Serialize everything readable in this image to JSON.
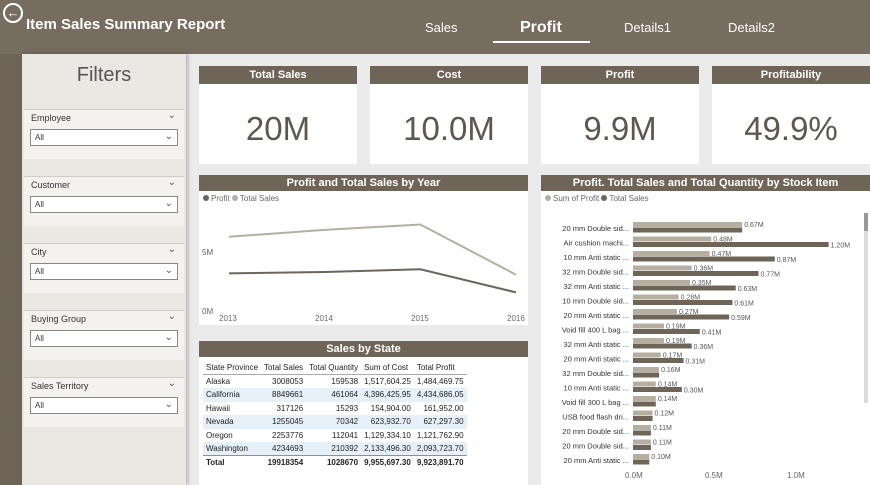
{
  "header": {
    "title": "Item Sales Summary Report",
    "tabs": [
      {
        "label": "Sales",
        "active": false
      },
      {
        "label": "Profit",
        "active": true
      },
      {
        "label": "Details1",
        "active": false
      },
      {
        "label": "Details2",
        "active": false
      }
    ]
  },
  "filters": {
    "title": "Filters",
    "slicers": [
      {
        "label": "Employee",
        "value": "All"
      },
      {
        "label": "Customer",
        "value": "All"
      },
      {
        "label": "City",
        "value": "All"
      },
      {
        "label": "Buying Group",
        "value": "All"
      },
      {
        "label": "Sales Territory",
        "value": "All"
      }
    ]
  },
  "cards": [
    {
      "title": "Total Sales",
      "value": "20M"
    },
    {
      "title": "Cost",
      "value": "10.0M"
    },
    {
      "title": "Profit",
      "value": "9.9M"
    },
    {
      "title": "Profitability",
      "value": "49.9%"
    }
  ],
  "colors": {
    "profit": "#6e6558",
    "sales": "#b7aea2",
    "header": "#766c5f"
  },
  "year_chart": {
    "title": "Profit and Total Sales by Year",
    "legend": [
      "Profit",
      "Total Sales"
    ],
    "y_ticks": [
      "5M",
      "0M"
    ],
    "x_ticks": [
      "2013",
      "2014",
      "2015",
      "2016"
    ]
  },
  "state_table": {
    "title": "Sales by State",
    "columns": [
      "State Province",
      "Total Sales",
      "Total Quantity",
      "Sum of Cost",
      "Total Profit"
    ],
    "rows": [
      [
        "Alaska",
        "3008053",
        "159538",
        "1,517,604.25",
        "1,484,469.75"
      ],
      [
        "California",
        "8849661",
        "461064",
        "4,396,425.95",
        "4,434,686.05"
      ],
      [
        "Hawaii",
        "317126",
        "15293",
        "154,904.00",
        "161,952.00"
      ],
      [
        "Nevada",
        "1255045",
        "70342",
        "623,932.70",
        "627,297.30"
      ],
      [
        "Oregon",
        "2253776",
        "112041",
        "1,129,334.10",
        "1,121,762.90"
      ],
      [
        "Washington",
        "4234693",
        "210392",
        "2,133,496.30",
        "2,093,723.70"
      ]
    ],
    "total": [
      "Total",
      "19918354",
      "1028670",
      "9,955,697.30",
      "9,923,891.70"
    ]
  },
  "item_chart": {
    "title": "Profit. Total Sales and Total Quantity by Stock Item",
    "legend": [
      "Sum of Profit",
      "Total Sales"
    ],
    "x_ticks": [
      "0.0M",
      "0.5M",
      "1.0M"
    ]
  },
  "chart_data": [
    {
      "type": "line",
      "title": "Profit and Total Sales by Year",
      "x": [
        2013,
        2014,
        2015,
        2016
      ],
      "series": [
        {
          "name": "Profit",
          "values": [
            2.7,
            2.8,
            3.0,
            1.3
          ]
        },
        {
          "name": "Total Sales",
          "values": [
            5.4,
            5.9,
            6.3,
            2.6
          ]
        }
      ],
      "y_unit": "M",
      "ylim": [
        0,
        7
      ],
      "legend_position": "top-left"
    },
    {
      "type": "bar",
      "orientation": "horizontal",
      "title": "Profit. Total Sales and Total Quantity by Stock Item",
      "categories": [
        "20 mm Double sid...",
        "Air cushion machi...",
        "10 mm Anti static ...",
        "32 mm Double sid...",
        "32 mm Anti static ...",
        "10 mm Double sid...",
        "20 mm Anti static ...",
        "Void fill 400 L bag ...",
        "32 mm Anti static ...",
        "20 mm Anti static ...",
        "32 mm Double sid...",
        "10 mm Anti static ...",
        "Void fill 300 L bag ...",
        "USB food flash dri...",
        "20 mm Double sid...",
        "20 mm Double sid...",
        "20 mm Anti static ..."
      ],
      "series": [
        {
          "name": "Sum of Profit",
          "values": [
            0.67,
            0.48,
            0.47,
            0.36,
            0.35,
            0.28,
            0.27,
            0.19,
            0.19,
            0.17,
            0.16,
            0.14,
            0.14,
            0.12,
            0.11,
            0.11,
            0.1
          ]
        },
        {
          "name": "Total Sales",
          "values": [
            0.67,
            1.2,
            0.87,
            0.77,
            0.63,
            0.61,
            0.59,
            0.41,
            0.36,
            0.31,
            0.16,
            0.3,
            0.14,
            0.12,
            0.11,
            0.11,
            0.1
          ]
        }
      ],
      "value_labels": {
        "profit": [
          "0.67M",
          "0.48M",
          "0.47M",
          "0.36M",
          "0.35M",
          "0.28M",
          "0.27M",
          "0.19M",
          "0.19M",
          "0.17M",
          "0.16M",
          "0.14M",
          "0.14M",
          "0.12M",
          "0.11M",
          "0.11M",
          "0.10M"
        ],
        "sales": [
          "",
          "1.20M",
          "0.87M",
          "0.77M",
          "0.63M",
          "0.61M",
          "0.59M",
          "0.41M",
          "0.36M",
          "0.31M",
          "",
          "0.30M",
          "",
          "",
          "",
          "",
          ""
        ]
      },
      "xlim": [
        0,
        1.3
      ],
      "x_unit": "M",
      "legend_position": "top-left"
    }
  ]
}
